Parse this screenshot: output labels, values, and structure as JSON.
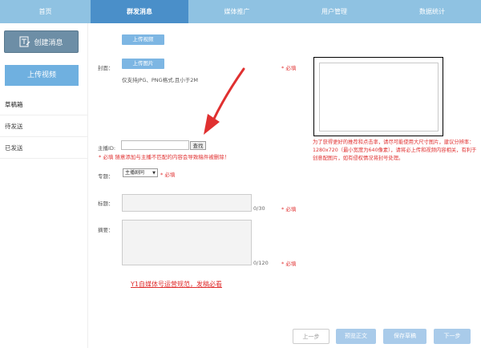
{
  "nav": {
    "tabs": [
      {
        "label": "首页",
        "width": 0
      },
      {
        "label": "群发消息"
      },
      {
        "label": "媒体推广"
      },
      {
        "label": "用户管理"
      },
      {
        "label": "数据统计"
      }
    ]
  },
  "sidebar": {
    "create_label": "创建消息",
    "upload_video_label": "上传视频",
    "items": [
      {
        "label": "草稿箱"
      },
      {
        "label": "待发送"
      },
      {
        "label": "已发送"
      }
    ]
  },
  "form": {
    "upload_video_button": "上传视频",
    "cover_label": "封面：",
    "upload_image_button": "上传图片",
    "cover_hint": "仅支持JPG、PNG格式,且小于2M",
    "required": "* 必填",
    "anchor_label": "主播ID:",
    "anchor_value": "",
    "search_button": "查找",
    "anchor_warning": "* 必填 随意添加与主播不匹配的内容会导致稿件被删除！",
    "topic_label": "专题：",
    "topic_selected": "主播剧同",
    "title_label": "标题：",
    "title_counter": "0/30",
    "summary_label": "摘要：",
    "summary_counter": "0/120",
    "notice_link": "Y1自媒体号运营规范，发稿必看"
  },
  "preview": {
    "note": "为了获得更好的推荐和点击率，请尽可能使用大尺寸图片，建议分辨率：1280x720（最小宽度为640像素），请将必上传和视频内容相关，有利于创意配图片，如有侵权情况将封号处理。"
  },
  "bottom": {
    "prev": "上一步",
    "preview": "预览正文",
    "save": "保存草稿",
    "next": "下一步"
  },
  "colors": {
    "nav_bg": "#8fc2e2",
    "nav_active": "#4a8fc9",
    "accent_red": "#e03030",
    "button_blue": "#7db6e3"
  }
}
